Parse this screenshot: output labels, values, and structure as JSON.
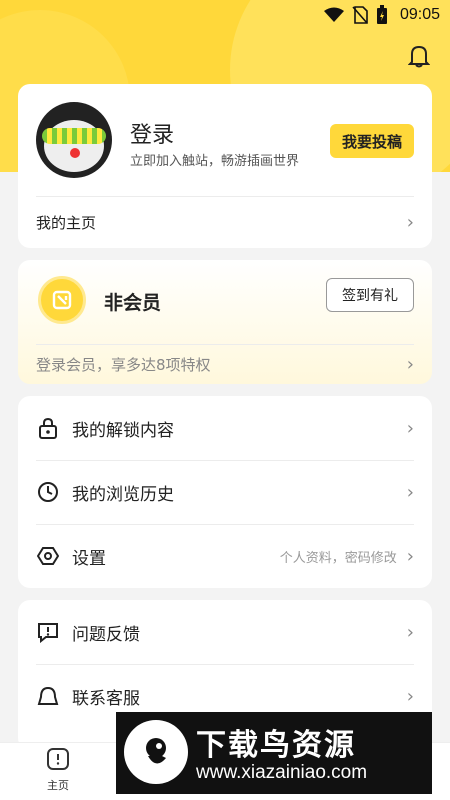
{
  "status_bar": {
    "time": "09:05",
    "icons": [
      "wifi-icon",
      "no-sim-icon",
      "battery-charging-icon"
    ]
  },
  "header": {
    "icon": "bell-icon"
  },
  "profile": {
    "title": "登录",
    "subtitle": "立即加入触站，畅游插画世界",
    "submit_label": "我要投稿",
    "home_link": "我的主页"
  },
  "vip": {
    "title": "非会员",
    "signin_label": "签到有礼",
    "benefit_text": "登录会员，享多达8项特权"
  },
  "menu_main": [
    {
      "label": "我的解锁内容",
      "icon": "lock-icon",
      "hint": ""
    },
    {
      "label": "我的浏览历史",
      "icon": "clock-icon",
      "hint": ""
    },
    {
      "label": "设置",
      "icon": "settings-icon",
      "hint": "个人资料，密码修改"
    }
  ],
  "menu_support": [
    {
      "label": "问题反馈",
      "icon": "feedback-icon"
    },
    {
      "label": "联系客服",
      "icon": "customer-service-icon"
    }
  ],
  "bottom_nav": {
    "home_label": "主页"
  },
  "watermark": {
    "title": "下载鸟资源",
    "url": "www.xiazainiao.com"
  },
  "colors": {
    "accent": "#ffd83a",
    "background": "#f3f3f3"
  }
}
